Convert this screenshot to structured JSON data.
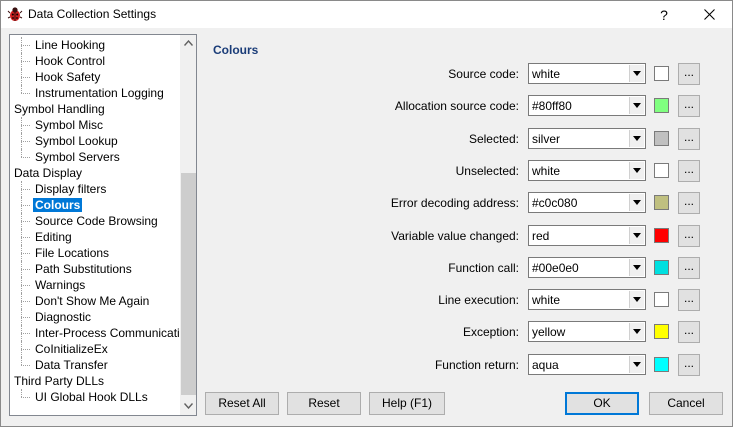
{
  "window": {
    "title": "Data Collection Settings",
    "help": "?"
  },
  "tree": {
    "items": [
      {
        "label": "Line Hooking",
        "level": 1
      },
      {
        "label": "Hook Control",
        "level": 1
      },
      {
        "label": "Hook Safety",
        "level": 1
      },
      {
        "label": "Instrumentation Logging",
        "level": 1,
        "last": true
      },
      {
        "label": "Symbol Handling",
        "level": 0
      },
      {
        "label": "Symbol Misc",
        "level": 1
      },
      {
        "label": "Symbol Lookup",
        "level": 1
      },
      {
        "label": "Symbol Servers",
        "level": 1,
        "last": true
      },
      {
        "label": "Data Display",
        "level": 0
      },
      {
        "label": "Display filters",
        "level": 1
      },
      {
        "label": "Colours",
        "level": 1,
        "selected": true
      },
      {
        "label": "Source Code Browsing",
        "level": 1
      },
      {
        "label": "Editing",
        "level": 1
      },
      {
        "label": "File Locations",
        "level": 1
      },
      {
        "label": "Path Substitutions",
        "level": 1
      },
      {
        "label": "Warnings",
        "level": 1
      },
      {
        "label": "Don't Show Me Again",
        "level": 1
      },
      {
        "label": "Diagnostic",
        "level": 1
      },
      {
        "label": "Inter-Process Communication",
        "level": 1
      },
      {
        "label": "CoInitializeEx",
        "level": 1
      },
      {
        "label": "Data Transfer",
        "level": 1,
        "last": true
      },
      {
        "label": "Third Party DLLs",
        "level": 0
      },
      {
        "label": "UI Global Hook DLLs",
        "level": 1,
        "last": true
      }
    ]
  },
  "section": {
    "title": "Colours"
  },
  "settings": [
    {
      "label": "Source code:",
      "value": "white",
      "color": "#ffffff"
    },
    {
      "label": "Allocation source code:",
      "value": "#80ff80",
      "color": "#80ff80"
    },
    {
      "label": "Selected:",
      "value": "silver",
      "color": "#c0c0c0"
    },
    {
      "label": "Unselected:",
      "value": "white",
      "color": "#ffffff"
    },
    {
      "label": "Error decoding address:",
      "value": "#c0c080",
      "color": "#c0c080"
    },
    {
      "label": "Variable value changed:",
      "value": "red",
      "color": "#ff0000"
    },
    {
      "label": "Function call:",
      "value": "#00e0e0",
      "color": "#00e0e0"
    },
    {
      "label": "Line execution:",
      "value": "white",
      "color": "#ffffff"
    },
    {
      "label": "Exception:",
      "value": "yellow",
      "color": "#ffff00"
    },
    {
      "label": "Function return:",
      "value": "aqua",
      "color": "#00ffff"
    }
  ],
  "more_label": "...",
  "buttons": {
    "reset_all": "Reset All",
    "reset": "Reset",
    "help": "Help (F1)",
    "ok": "OK",
    "cancel": "Cancel"
  },
  "colors": {
    "accent": "#0078d7",
    "section_title": "#1a3c78"
  }
}
